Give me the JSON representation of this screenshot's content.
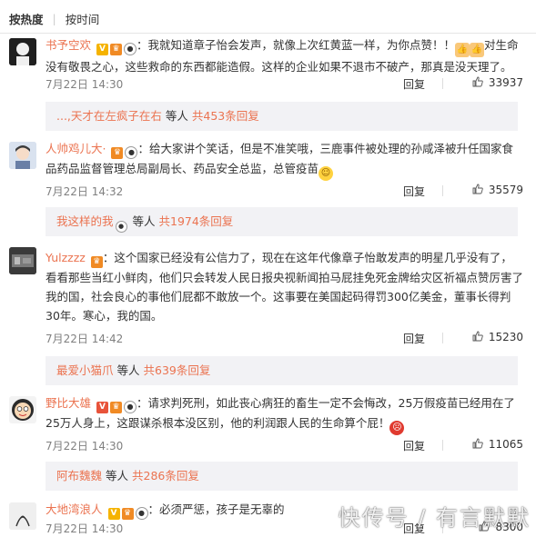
{
  "sort_tabs": {
    "hot": "按热度",
    "time": "按时间"
  },
  "comments": [
    {
      "user": "书予空欢",
      "text": "我就知道章子怡会发声，就像上次红黄蓝一样，为你点赞！！",
      "text2": "对生命没有敬畏之心，这些救命的东西都能造假。这样的企业如果不退市不破产，那真是没天理了。",
      "time": "7月22日 14:30",
      "reply": "回复",
      "likes": "33937",
      "reply_user": "...,天才在左疯子在右",
      "reply_text": "等人",
      "reply_count": "共453条回复"
    },
    {
      "user": "人帅鸡儿大·",
      "text": "给大家讲个笑话，但是不准笑哦，三鹿事件被处理的孙咸泽被升任国家食品药品监督管理总局副局长、药品安全总监，总管疫苗",
      "time": "7月22日 14:32",
      "reply": "回复",
      "likes": "35579",
      "reply_user": "我这样的我",
      "reply_text": "等人",
      "reply_count": "共1974条回复"
    },
    {
      "user": "Yulzzzz",
      "text": "这个国家已经没有公信力了，现在在这年代像章子怡敢发声的明星几乎没有了，看看那些当红小鲜肉，他们只会转发人民日报央视新闻拍马屁挂免死金牌给灾区祈福点赞厉害了我的国，社会良心的事他们屁都不敢放一个。这事要在美国起码得罚300亿美金，董事长得判30年。寒心，我的国。",
      "time": "7月22日 14:42",
      "reply": "回复",
      "likes": "15230",
      "reply_user": "最爱小猫爪",
      "reply_text": "等人",
      "reply_count": "共639条回复"
    },
    {
      "user": "野比大雄",
      "text": "请求判死刑，如此丧心病狂的畜生一定不会悔改，25万假疫苗已经用在了25万人身上，这跟谋杀根本没区别，他的利润跟人民的生命算个屁！",
      "time": "7月22日 14:30",
      "reply": "回复",
      "likes": "11065",
      "reply_user": "阿布魏魏",
      "reply_text": "等人",
      "reply_count": "共286条回复"
    },
    {
      "user": "大地湾浪人",
      "text": "必须严惩，孩子是无辜的",
      "time": "7月22日 14:30",
      "reply": "回复",
      "likes": "8300"
    }
  ],
  "watermark": "快传号 / 有言默默",
  "colors": {
    "accent": "#eb7350",
    "text": "#333333",
    "muted": "#808080",
    "reply_bg": "#f2f2f5"
  }
}
